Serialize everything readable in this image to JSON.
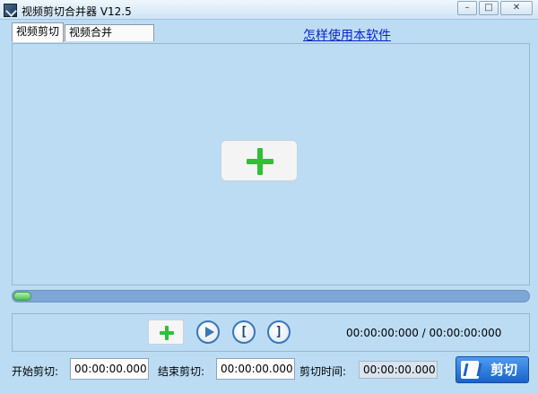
{
  "window": {
    "title": "视频剪切合并器 V12.5",
    "minimize": "–",
    "maximize": "□",
    "close": "✕"
  },
  "tabs": [
    {
      "label": "视频剪切",
      "active": true
    },
    {
      "label": "视频合并",
      "active": false
    }
  ],
  "help_link": "怎样使用本软件",
  "icons": {
    "app": "app-icon",
    "add_big": "plus-icon",
    "add_small": "plus-icon",
    "play": "play-icon",
    "mark_start": "[",
    "mark_end": "]",
    "cut": "scissors-icon"
  },
  "colors": {
    "background": "#bcdcf3",
    "link": "#0a26c9",
    "plus": "#2fbf38",
    "cut_button": "#1a63c9"
  },
  "progress": {
    "fraction": 0.0
  },
  "time_display": "00:00:00:000 / 00:00:00:000",
  "start_cut": {
    "label": "开始剪切:",
    "value": "00:00:00.000"
  },
  "end_cut": {
    "label": "结束剪切:",
    "value": "00:00:00.000"
  },
  "cut_duration": {
    "label": "剪切时间:",
    "value": "00:00:00.000"
  },
  "cut_button": {
    "label": "剪切"
  }
}
